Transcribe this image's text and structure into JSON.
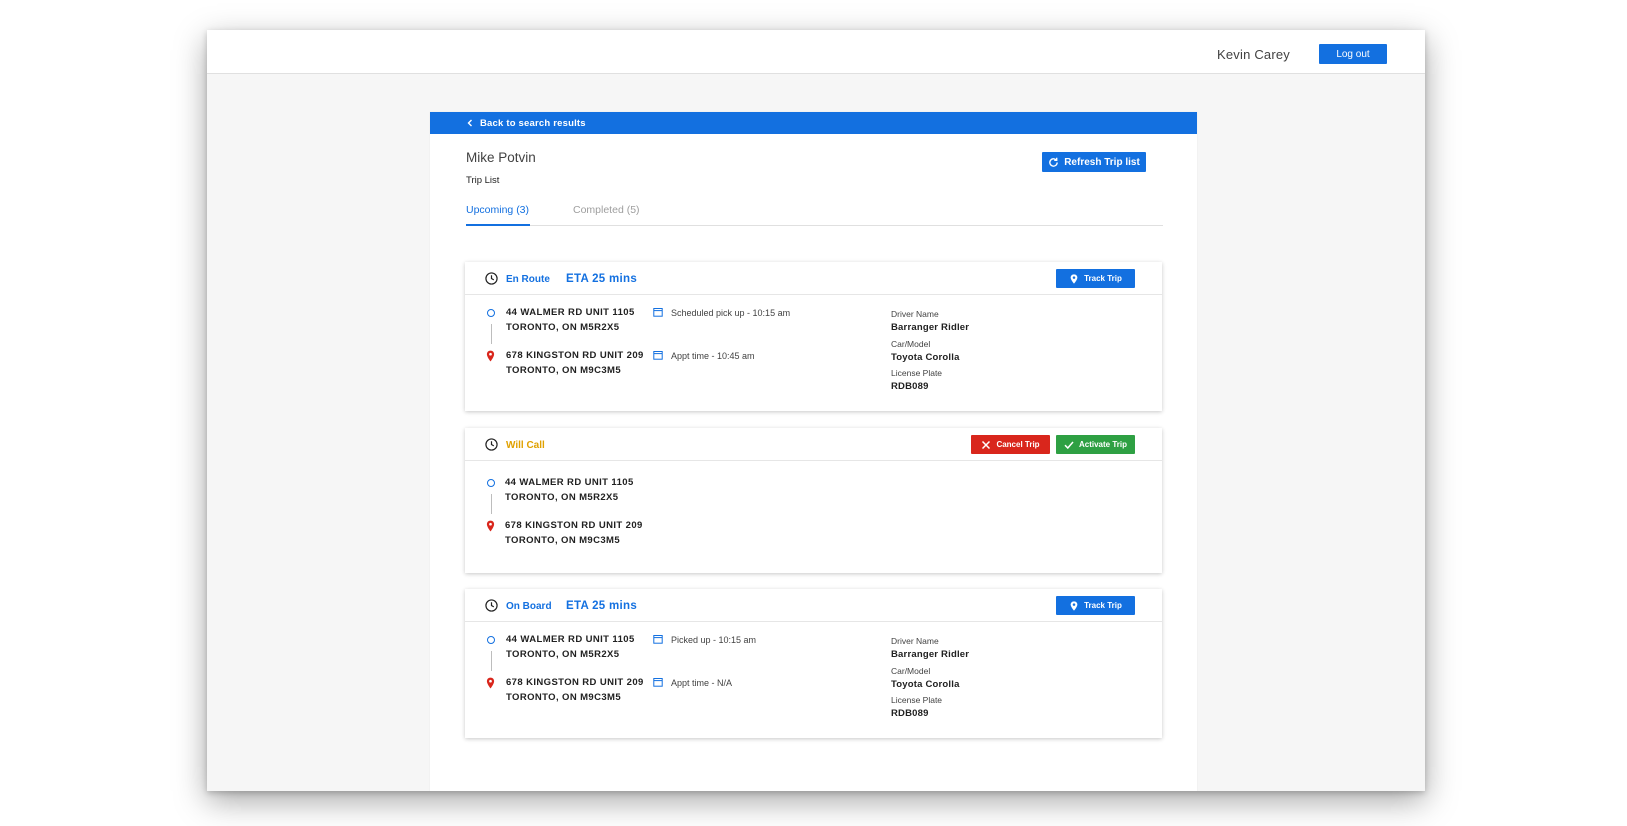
{
  "header": {
    "user_name": "Kevin Carey",
    "logout_label": "Log out"
  },
  "panel": {
    "back_label": "Back to search results",
    "client_name": "Mike Potvin",
    "section_label": "Trip List",
    "refresh_label": "Refresh Trip list",
    "tabs": [
      {
        "label": "Upcoming (3)",
        "active": true
      },
      {
        "label": "Completed (5)",
        "active": false
      }
    ]
  },
  "trips": [
    {
      "status": "En Route",
      "status_color": "#1370e0",
      "eta": "ETA 25 mins",
      "action_label": "Track Trip",
      "pickup_line1": "44 WALMER RD UNIT 1105",
      "pickup_line2": "TORONTO, ON M5R2X5",
      "dropoff_line1": "678 KINGSTON RD UNIT 209",
      "dropoff_line2": "TORONTO, ON M9C3M5",
      "time1": "Scheduled pick up - 10:15 am",
      "time2": "Appt time - 10:45 am",
      "driver_label": "Driver Name",
      "driver": "Barranger Ridler",
      "car_label": "Car/Model",
      "car": "Toyota Corolla",
      "plate_label": "License Plate",
      "plate": "RDB089"
    },
    {
      "status": "Will Call",
      "status_color": "#e0a100",
      "cancel_label": "Cancel Trip",
      "activate_label": "Activate Trip",
      "pickup_line1": "44 WALMER RD UNIT 1105",
      "pickup_line2": "TORONTO, ON M5R2X5",
      "dropoff_line1": "678 KINGSTON RD UNIT 209",
      "dropoff_line2": "TORONTO, ON M9C3M5"
    },
    {
      "status": "On Board",
      "status_color": "#1370e0",
      "eta": "ETA 25 mins",
      "action_label": "Track Trip",
      "pickup_line1": "44 WALMER RD UNIT 1105",
      "pickup_line2": "TORONTO, ON M5R2X5",
      "dropoff_line1": "678 KINGSTON RD UNIT 209",
      "dropoff_line2": "TORONTO, ON M9C3M5",
      "time1": "Picked up - 10:15 am",
      "time2": "Appt time - N/A",
      "driver_label": "Driver Name",
      "driver": "Barranger Ridler",
      "car_label": "Car/Model",
      "car": "Toyota Corolla",
      "plate_label": "License Plate",
      "plate": "RDB089"
    }
  ],
  "icons": {
    "back": "chevron-left-icon",
    "refresh": "refresh-icon",
    "clock": "clock-icon",
    "track": "location-pin-icon",
    "cancel": "close-icon",
    "activate": "check-icon",
    "calendar": "calendar-icon",
    "origin": "origin-dot-icon",
    "destination": "destination-pin-icon"
  },
  "colors": {
    "primary": "#1370e0",
    "danger": "#d9261c",
    "success": "#2ea043",
    "will_call": "#e0a100",
    "pin": "#d9261c"
  }
}
